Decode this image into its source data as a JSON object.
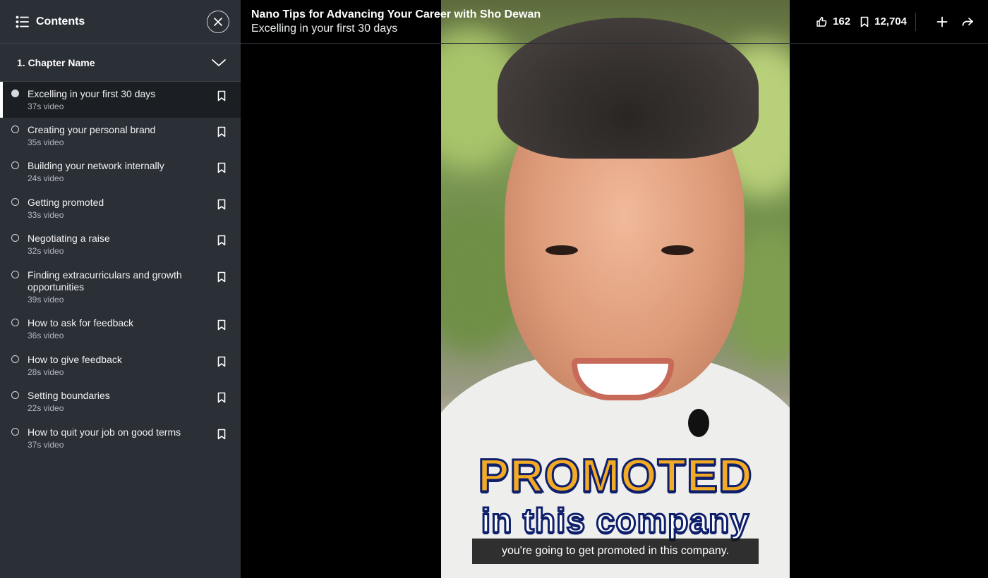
{
  "sidebar": {
    "title": "Contents",
    "chapter": "1. Chapter Name",
    "items": [
      {
        "title": "Excelling in your first 30 days",
        "duration": "37s video",
        "active": true
      },
      {
        "title": "Creating your personal brand",
        "duration": "35s video"
      },
      {
        "title": "Building your network internally",
        "duration": "24s video"
      },
      {
        "title": "Getting promoted",
        "duration": "33s video"
      },
      {
        "title": "Negotiating a raise",
        "duration": "32s video"
      },
      {
        "title": "Finding extracurriculars and growth opportunities",
        "duration": "39s video"
      },
      {
        "title": "How to ask for feedback",
        "duration": "36s video"
      },
      {
        "title": "How to give feedback",
        "duration": "28s video"
      },
      {
        "title": "Setting boundaries",
        "duration": "22s video"
      },
      {
        "title": "How to quit your job on good terms",
        "duration": "37s video"
      }
    ]
  },
  "header": {
    "course_title": "Nano Tips for Advancing Your Career with Sho Dewan",
    "video_title": "Excelling in your first 30 days",
    "likes": "162",
    "saves": "12,704"
  },
  "video": {
    "caption_line1": "PROMOTED",
    "caption_line2": "in this company",
    "subtitle": "you're going to get promoted in this company."
  },
  "colors": {
    "sidebar_bg": "#2b2f36",
    "caption_yellow": "#f3aa24",
    "caption_outline": "#0e1f6b"
  },
  "icons": [
    "list-icon",
    "close-icon",
    "chevron-down-icon",
    "bookmark-icon",
    "thumbs-up-icon",
    "plus-icon",
    "share-icon"
  ]
}
